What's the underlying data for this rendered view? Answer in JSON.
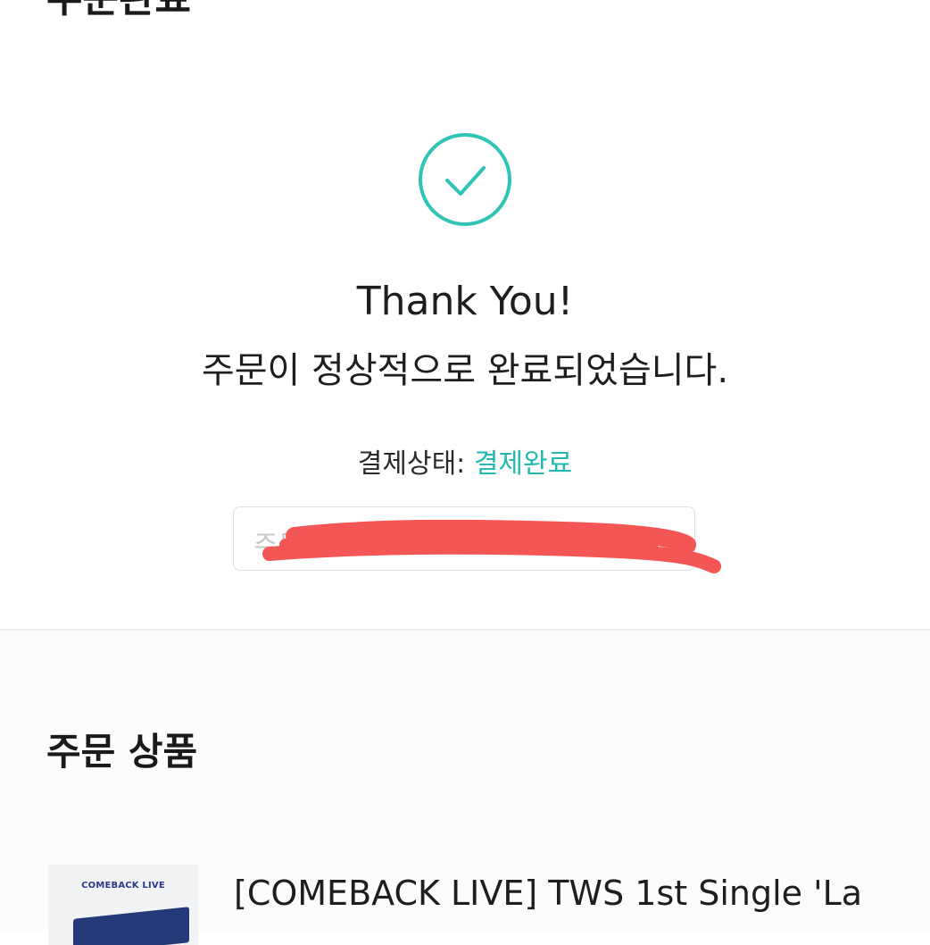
{
  "header": {
    "title": "주문완료"
  },
  "confirmation": {
    "icon": "check-circle-icon",
    "thank_you": "Thank You!",
    "message": "주문이 정상적으로 완료되었습니다.",
    "payment_status_label": "결제상태:",
    "payment_status_value": "결제완료",
    "order_number_placeholder": "주문번호"
  },
  "order_items": {
    "section_title": "주문 상품",
    "items": [
      {
        "thumbnail_text": "COMEBACK LIVE",
        "name": "[COMEBACK LIVE] TWS 1st Single 'La"
      }
    ]
  },
  "colors": {
    "accent": "#22b8b0",
    "redaction": "#f45555"
  }
}
